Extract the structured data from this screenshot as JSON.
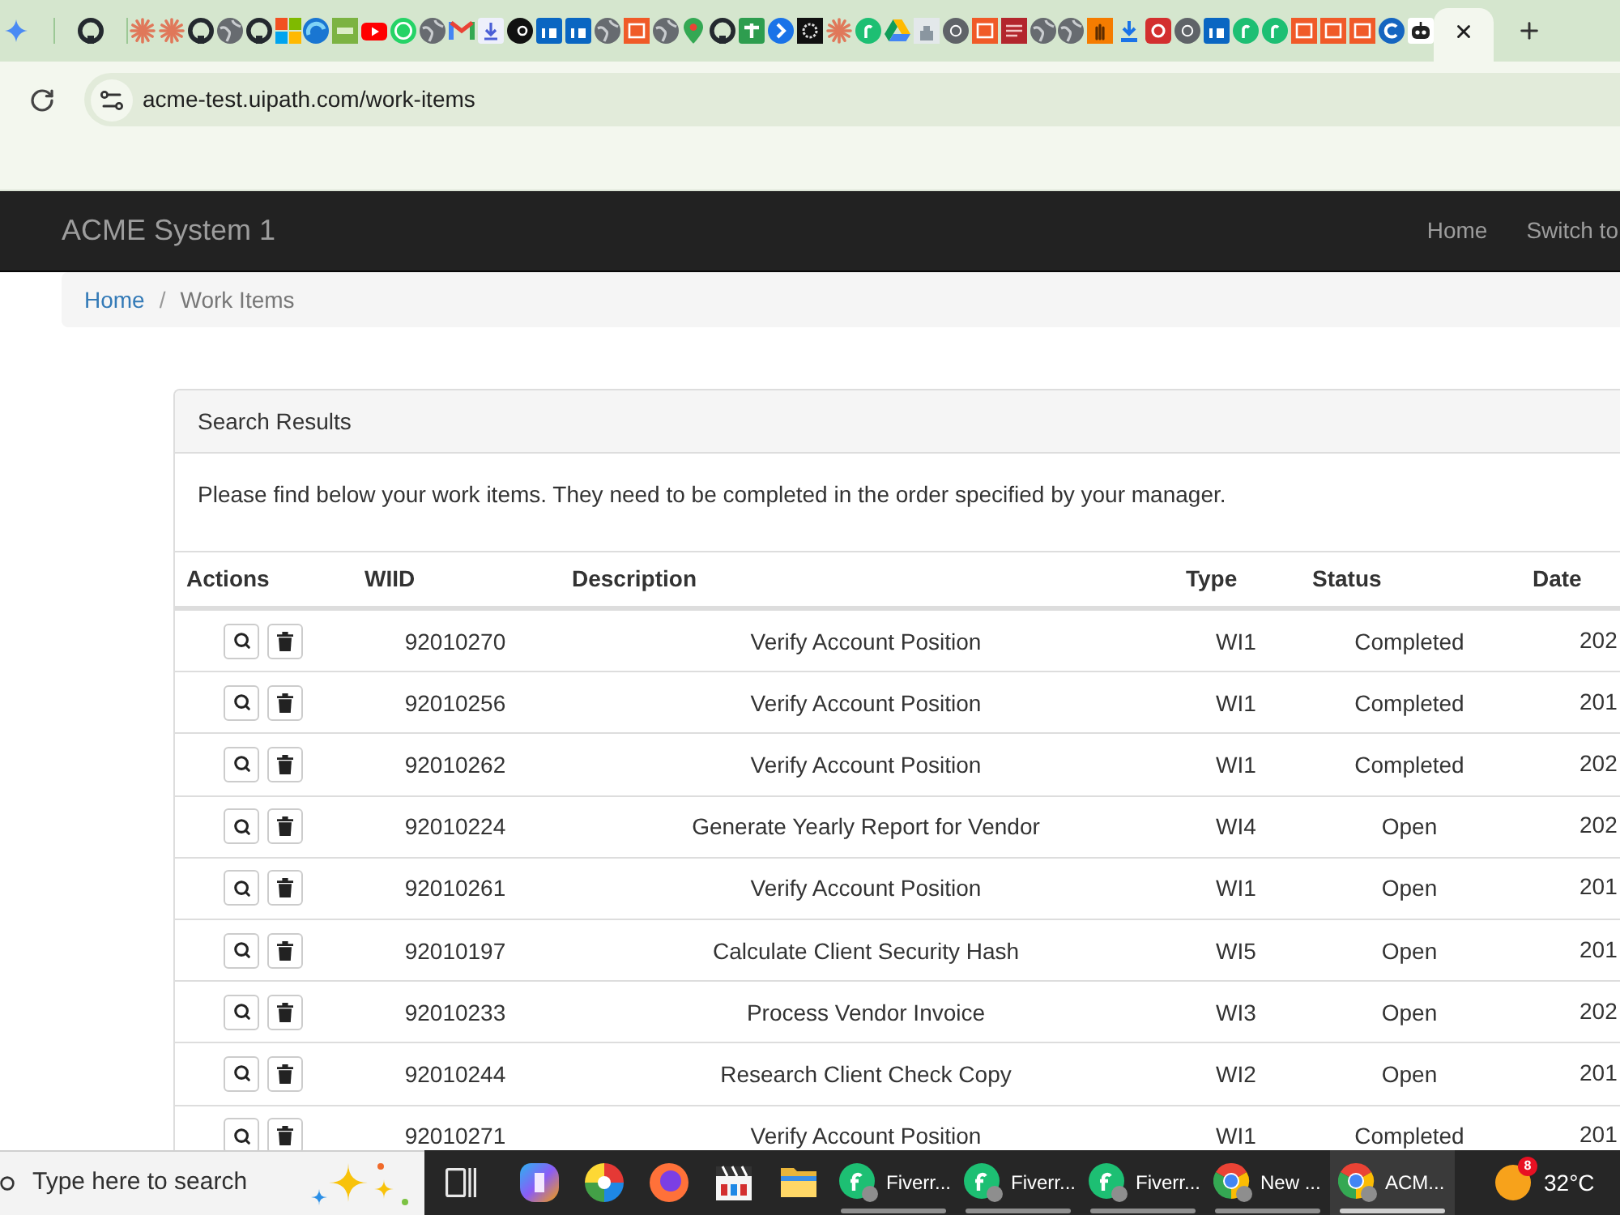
{
  "browser": {
    "tabs": [
      {
        "kind": "gemini",
        "pinned": true,
        "selected": false
      },
      {
        "kind": "github",
        "pinned": true,
        "selected": false
      },
      {
        "kind": "asterisk",
        "pinned": false,
        "selected": false
      },
      {
        "kind": "asterisk",
        "pinned": false,
        "selected": false
      },
      {
        "kind": "github",
        "pinned": false,
        "selected": false
      },
      {
        "kind": "globe",
        "pinned": false,
        "selected": false
      },
      {
        "kind": "github",
        "pinned": false,
        "selected": false
      },
      {
        "kind": "microsoft",
        "pinned": false,
        "selected": false
      },
      {
        "kind": "swoosh",
        "pinned": false,
        "selected": false
      },
      {
        "kind": "slr",
        "pinned": false,
        "selected": false
      },
      {
        "kind": "youtube",
        "pinned": false,
        "selected": false
      },
      {
        "kind": "whatsapp",
        "pinned": false,
        "selected": false
      },
      {
        "kind": "globe",
        "pinned": false,
        "selected": false
      },
      {
        "kind": "gmail",
        "pinned": false,
        "selected": false
      },
      {
        "kind": "document",
        "pinned": false,
        "selected": false
      },
      {
        "kind": "upwork",
        "pinned": false,
        "selected": false
      },
      {
        "kind": "linkedin",
        "pinned": false,
        "selected": false
      },
      {
        "kind": "linkedin",
        "pinned": false,
        "selected": false
      },
      {
        "kind": "globe",
        "pinned": false,
        "selected": false
      },
      {
        "kind": "uipath",
        "pinned": false,
        "selected": false
      },
      {
        "kind": "globe",
        "pinned": false,
        "selected": false
      },
      {
        "kind": "maps",
        "pinned": false,
        "selected": false
      },
      {
        "kind": "github",
        "pinned": false,
        "selected": false
      },
      {
        "kind": "plus-tile",
        "pinned": false,
        "selected": false
      },
      {
        "kind": "chevron-circle",
        "pinned": false,
        "selected": false
      },
      {
        "kind": "pattern-tile",
        "pinned": false,
        "selected": false
      },
      {
        "kind": "asterisk",
        "pinned": false,
        "selected": false
      },
      {
        "kind": "fiverr",
        "pinned": false,
        "selected": false
      },
      {
        "kind": "drive",
        "pinned": false,
        "selected": false
      },
      {
        "kind": "emblem",
        "pinned": false,
        "selected": false
      },
      {
        "kind": "chrome",
        "pinned": false,
        "selected": false
      },
      {
        "kind": "uipath",
        "pinned": false,
        "selected": false
      },
      {
        "kind": "lines-tile",
        "pinned": false,
        "selected": false
      },
      {
        "kind": "globe",
        "pinned": false,
        "selected": false
      },
      {
        "kind": "globe",
        "pinned": false,
        "selected": false
      },
      {
        "kind": "hand",
        "pinned": false,
        "selected": false
      },
      {
        "kind": "download",
        "pinned": false,
        "selected": false
      },
      {
        "kind": "ring-tile",
        "pinned": false,
        "selected": false
      },
      {
        "kind": "chrome",
        "pinned": false,
        "selected": false
      },
      {
        "kind": "linkedin",
        "pinned": false,
        "selected": false
      },
      {
        "kind": "fiverr",
        "pinned": false,
        "selected": false
      },
      {
        "kind": "fiverr",
        "pinned": false,
        "selected": false
      },
      {
        "kind": "uipath",
        "pinned": false,
        "selected": false
      },
      {
        "kind": "uipath",
        "pinned": false,
        "selected": false
      },
      {
        "kind": "uipath",
        "pinned": false,
        "selected": false
      },
      {
        "kind": "c-circle",
        "pinned": false,
        "selected": false
      },
      {
        "kind": "robot",
        "pinned": false,
        "selected": false
      },
      {
        "pinned": false,
        "selected": true
      }
    ],
    "address": "acme-test.uipath.com/work-items"
  },
  "navbar": {
    "brand": "ACME System 1",
    "links": [
      "Home",
      "Switch to"
    ]
  },
  "breadcrumb": {
    "separator": "/",
    "items": [
      {
        "label": "Home",
        "active": false
      },
      {
        "label": "Work Items",
        "active": true
      }
    ]
  },
  "panel": {
    "title": "Search Results",
    "intro": "Please find below your work items. They need to be completed in the order specified by your manager.",
    "table": {
      "columns": [
        "Actions",
        "WIID",
        "Description",
        "Type",
        "Status",
        "Date"
      ],
      "rows": [
        {
          "wiid": "92010270",
          "description": "Verify Account Position",
          "type": "WI1",
          "status": "Completed",
          "date": "202"
        },
        {
          "wiid": "92010256",
          "description": "Verify Account Position",
          "type": "WI1",
          "status": "Completed",
          "date": "201"
        },
        {
          "wiid": "92010262",
          "description": "Verify Account Position",
          "type": "WI1",
          "status": "Completed",
          "date": "202"
        },
        {
          "wiid": "92010224",
          "description": "Generate Yearly Report for Vendor",
          "type": "WI4",
          "status": "Open",
          "date": "202"
        },
        {
          "wiid": "92010261",
          "description": "Verify Account Position",
          "type": "WI1",
          "status": "Open",
          "date": "201"
        },
        {
          "wiid": "92010197",
          "description": "Calculate Client Security Hash",
          "type": "WI5",
          "status": "Open",
          "date": "201"
        },
        {
          "wiid": "92010233",
          "description": "Process Vendor Invoice",
          "type": "WI3",
          "status": "Open",
          "date": "202"
        },
        {
          "wiid": "92010244",
          "description": "Research Client Check Copy",
          "type": "WI2",
          "status": "Open",
          "date": "201"
        },
        {
          "wiid": "92010271",
          "description": "Verify Account Position",
          "type": "WI1",
          "status": "Completed",
          "date": "201"
        }
      ]
    }
  },
  "taskbar": {
    "search": {
      "placeholder": "Type here to search"
    },
    "apps": [
      {
        "kind": "fiverr",
        "label": "Fiverr...",
        "selected": false
      },
      {
        "kind": "fiverr",
        "label": "Fiverr...",
        "selected": false
      },
      {
        "kind": "fiverr",
        "label": "Fiverr...",
        "selected": false
      },
      {
        "kind": "chrome",
        "label": "New ...",
        "selected": false
      },
      {
        "kind": "chrome",
        "label": "ACM...",
        "selected": true
      }
    ],
    "weather": {
      "badge": "8",
      "temperature": "32°C"
    }
  }
}
